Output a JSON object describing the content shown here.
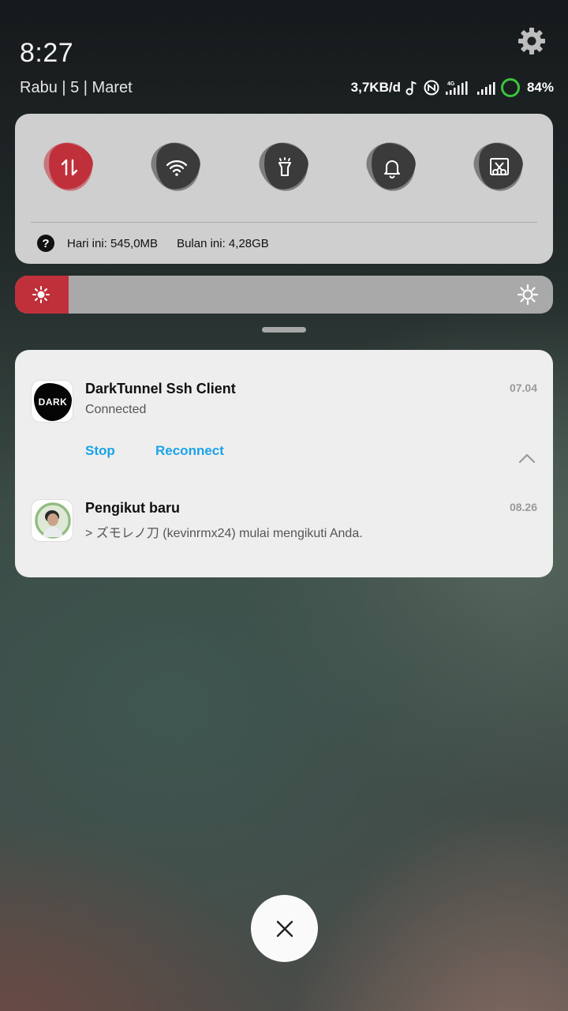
{
  "status_bar": {
    "time": "8:27",
    "date": "Rabu | 5 | Maret",
    "net_speed": "3,7KB/d",
    "network_type": "4G",
    "battery_percent": "84%",
    "battery_level": 0.84,
    "icons": [
      "music-note-icon",
      "nfc-icon",
      "signal-4g-icon",
      "signal-icon",
      "battery-ring-icon",
      "settings-gear-icon"
    ]
  },
  "quick_settings": {
    "toggles": [
      {
        "name": "mobile-data",
        "icon": "data-arrows-icon",
        "active": true,
        "color": "#c0303a"
      },
      {
        "name": "wifi",
        "icon": "wifi-icon",
        "active": false,
        "color": "#3b3b3b"
      },
      {
        "name": "flashlight",
        "icon": "flashlight-icon",
        "active": false,
        "color": "#3b3b3b"
      },
      {
        "name": "sound",
        "icon": "bell-icon",
        "active": false,
        "color": "#3b3b3b"
      },
      {
        "name": "screenshot",
        "icon": "scissors-icon",
        "active": false,
        "color": "#3b3b3b"
      }
    ],
    "data_usage": {
      "today": "Hari ini: 545,0MB",
      "month": "Bulan ini: 4,28GB"
    }
  },
  "brightness": {
    "level": 0.1,
    "color": "#c0303a"
  },
  "notifications": [
    {
      "app_title": "DarkTunnel Ssh Client",
      "logo_text": "DARK",
      "text": "Connected",
      "time": "07.04",
      "actions": [
        "Stop",
        "Reconnect"
      ]
    },
    {
      "app_title": "Pengikut baru",
      "text": "> ズモレノ刀 (kevinrmx24) mulai mengikuti Anda.",
      "time": "08.26"
    }
  ],
  "colors": {
    "accent_red": "#c0303a",
    "link_blue": "#1aa3e8",
    "battery_green": "#3cc43c"
  }
}
